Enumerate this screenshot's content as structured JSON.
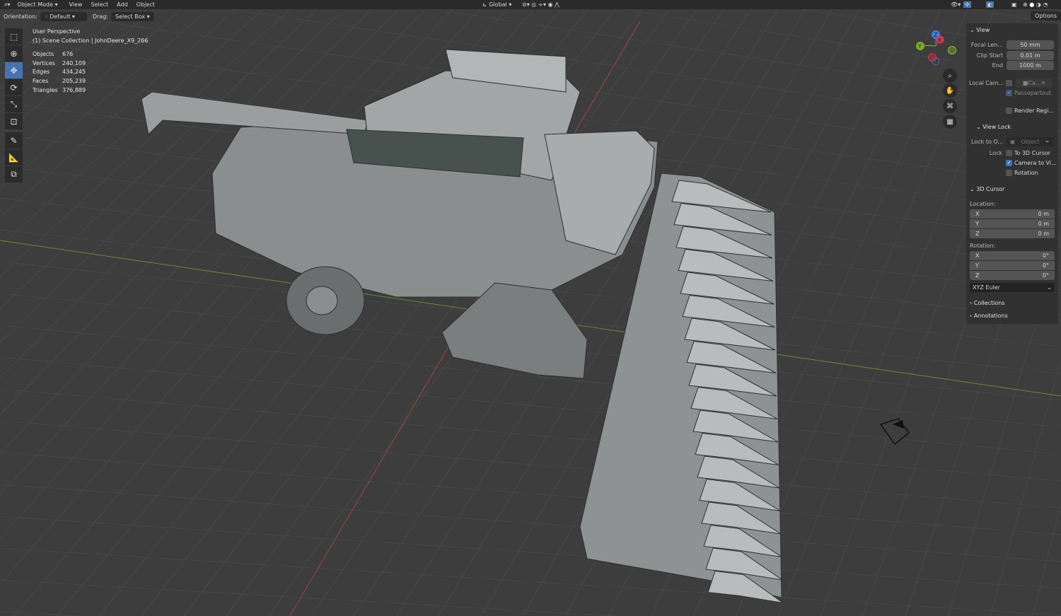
{
  "header": {
    "mode": "Object Mode",
    "menus": [
      "View",
      "Select",
      "Add",
      "Object"
    ],
    "transform": "Global",
    "options": "Options"
  },
  "toolbar": {
    "orientation_label": "Orientation:",
    "orientation_value": "Default",
    "drag_label": "Drag:",
    "drag_value": "Select Box"
  },
  "overlay": {
    "view_name": "User Perspective",
    "collection": "(1) Scene Collection | JohnDeere_X9_266",
    "stats": [
      {
        "label": "Objects",
        "value": "676"
      },
      {
        "label": "Vertices",
        "value": "240,109"
      },
      {
        "label": "Edges",
        "value": "434,245"
      },
      {
        "label": "Faces",
        "value": "205,239"
      },
      {
        "label": "Triangles",
        "value": "376,889"
      }
    ]
  },
  "gizmo": {
    "x": "X",
    "y": "Y",
    "z": "Z"
  },
  "sidebar": {
    "view": {
      "title": "View",
      "focal_label": "Focal Len...",
      "focal": "50 mm",
      "clip_start_label": "Clip Start",
      "clip_start": "0.01 m",
      "end_label": "End",
      "end": "1000 m",
      "local_cam_label": "Local Cam...",
      "local_cam_value": "Ca...",
      "passepartout": "Passepartout",
      "render_region": "Render Regi..."
    },
    "view_lock": {
      "title": "View Lock",
      "lock_to_label": "Lock to O...",
      "lock_to_value": "Object",
      "lock_label": "Lock",
      "to_cursor": "To 3D Cursor",
      "camera_to_view": "Camera to Vi...",
      "rotation": "Rotation"
    },
    "cursor": {
      "title": "3D Cursor",
      "location_label": "Location:",
      "loc": [
        {
          "axis": "X",
          "value": "0 m"
        },
        {
          "axis": "Y",
          "value": "0 m"
        },
        {
          "axis": "Z",
          "value": "0 m"
        }
      ],
      "rotation_label": "Rotation:",
      "rot": [
        {
          "axis": "X",
          "value": "0°"
        },
        {
          "axis": "Y",
          "value": "0°"
        },
        {
          "axis": "Z",
          "value": "0°"
        }
      ],
      "rotation_mode": "XYZ Euler"
    },
    "collections": "Collections",
    "annotations": "Annotations"
  }
}
